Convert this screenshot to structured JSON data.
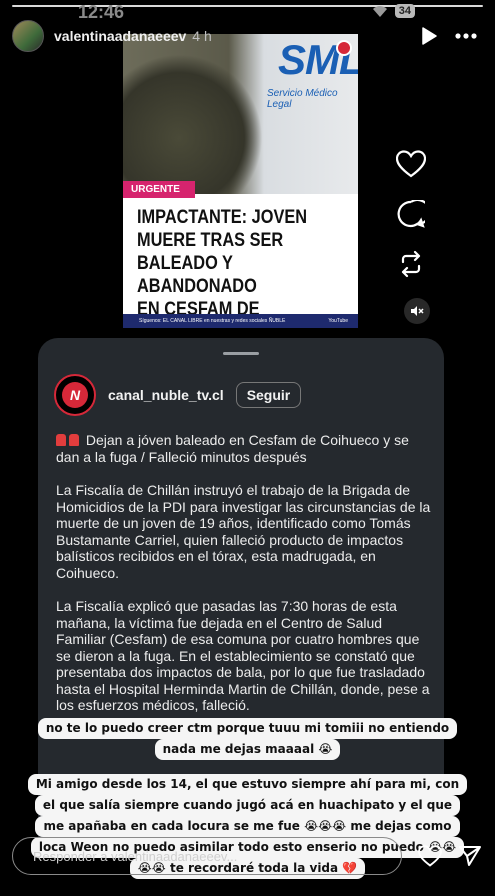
{
  "status_bar": {
    "time": "12:46",
    "battery": "34"
  },
  "header": {
    "username": "valentinaadanaeeev",
    "time_ago": "4 h"
  },
  "news_card": {
    "logo_text": "SML",
    "logo_subtitle": "Servicio Médico Legal",
    "badge": "URGENTE",
    "headline_lines": [
      "IMPACTANTE: JOVEN",
      "MUERE TRAS SER",
      "BALEADO Y ABANDONADO",
      "EN CESFAM DE COIHUECO"
    ],
    "footer_text": "Síguenos: EL CANAL LIBRE en nuestras y redes sociales ÑUBLE",
    "footer_yt": "YouTube"
  },
  "post": {
    "account": "canal_nuble_tv.cl",
    "follow_label": "Seguir",
    "logo_text": "N",
    "paragraphs": [
      "Dejan a jóven baleado en Cesfam de Coihueco y se dan a la fuga / Falleció minutos después",
      "La Fiscalía de Chillán instruyó el trabajo de la Brigada de Homicidios de la PDI para investigar las circunstancias de la muerte de un joven de 19 años, identificado como Tomás Bustamante Carriel, quien falleció producto de impactos balísticos recibidos en el tórax, esta madrugada, en Coihueco.",
      "La Fiscalía explicó que pasadas las 7:30 horas de esta mañana, la víctima fue dejada en el Centro de Salud Familiar (Cesfam) de esa comuna por cuatro hombres que se dieron a la fuga. En el establecimiento se constató que presentaba dos impactos de bala, por lo que fue trasladado hasta el Hospital Herminda Martin de Chillán, donde, pese a los esfuerzos médicos, falleció."
    ]
  },
  "overlay_text": {
    "first": [
      "no te lo puedo creer ctm porque tuuu mi tomiii no entiendo",
      "nada me dejas maaaal 😭"
    ],
    "second": [
      "Mi amigo desde los 14, el que estuvo siempre ahí para mi, con",
      "el que salía siempre cuando jugó acá en huachipato y el que",
      "me apañaba en cada locura se me fue 😭😭😭 me dejas como",
      "loca Weon no puedo asimilar todo esto enserio no puedo 😭😭",
      "😭😭 te recordaré toda la vida 💔"
    ]
  },
  "reply": {
    "placeholder": "Responder a valentinaadanaeeev..."
  },
  "icons": [
    "play-icon",
    "more-icon",
    "heart-icon",
    "comment-icon",
    "repost-icon",
    "mute-icon",
    "send-icon"
  ]
}
